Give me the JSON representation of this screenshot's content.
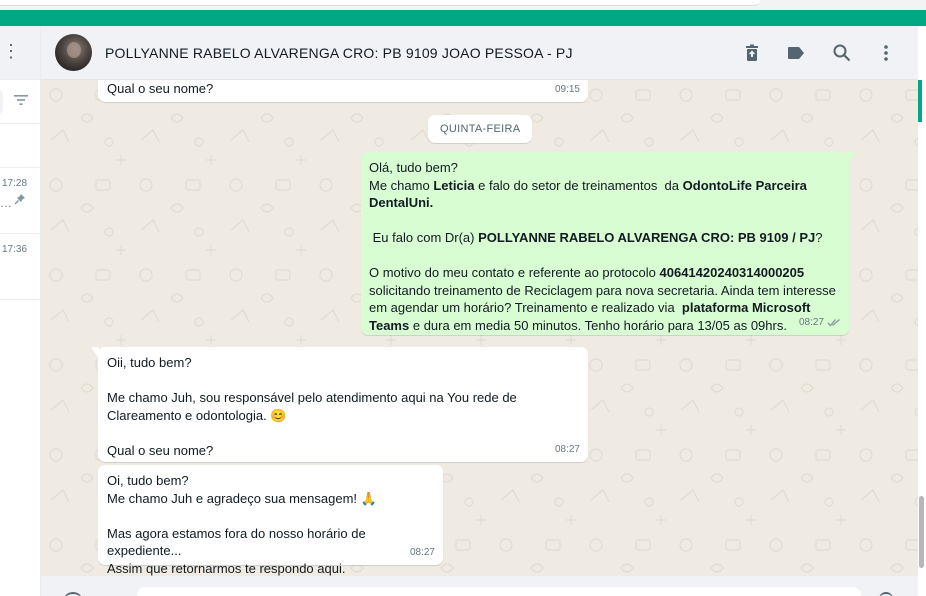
{
  "left": {
    "items": [
      {
        "time": "17:28",
        "snippet": "…"
      },
      {
        "time": "17:36"
      }
    ]
  },
  "header": {
    "title": "POLLYANNE RABELO ALVARENGA CRO: PB  9109 JOAO PESSOA - PJ",
    "icons": [
      "delete-icon",
      "label-icon",
      "search-icon",
      "menu-icon"
    ]
  },
  "messages": [
    {
      "id": "m0",
      "direction": "in",
      "text": "Qual o seu nome?",
      "time": "09:15"
    },
    {
      "id": "date",
      "type": "date",
      "text": "QUINTA-FEIRA"
    },
    {
      "id": "m1",
      "direction": "out",
      "time": "08:27",
      "status": "read",
      "parts": {
        "l1": "Olá, tudo bem?",
        "l2a": "Me chamo ",
        "l2b": "Leticia",
        "l2c": " e falo do setor de treinamentos  da ",
        "l2d": "OdontoLife Parceira DentalUni.",
        "l3a": " Eu falo com Dr(a) ",
        "l3b": "POLLYANNE RABELO ALVARENGA CRO: PB 9109 / PJ",
        "l3c": "?",
        "l4a": "O motivo do meu contato e referente ao protocolo ",
        "l4b": "40641420240314000205",
        "l4c": " solicitando treinamento de Reciclagem para nova secretaria. Ainda tem interesse em agendar um horário? Treinamento e realizado via  ",
        "l4d": "plataforma Microsoft Teams",
        "l4e": " e dura em media 50 minutos. Tenho horário para 13/05 as 09hrs."
      }
    },
    {
      "id": "m2",
      "direction": "in",
      "time": "08:27",
      "text": "Oii, tudo bem?\n\nMe chamo Juh, sou responsável pelo atendimento aqui na You rede de Clareamento e odontologia. 😊\n\nQual o seu nome?"
    },
    {
      "id": "m3",
      "direction": "in",
      "time": "08:27",
      "text": "Oi, tudo bem?\nMe chamo Juh e agradeço sua mensagem! 🙏\n\nMas agora estamos fora do nosso horário de expediente...\nAssim que retornarmos te respondo aqui."
    }
  ],
  "colors": {
    "accent": "#00a884",
    "outgoing": "#d9fdd3",
    "incoming": "#ffffff",
    "background": "#efeae2"
  }
}
